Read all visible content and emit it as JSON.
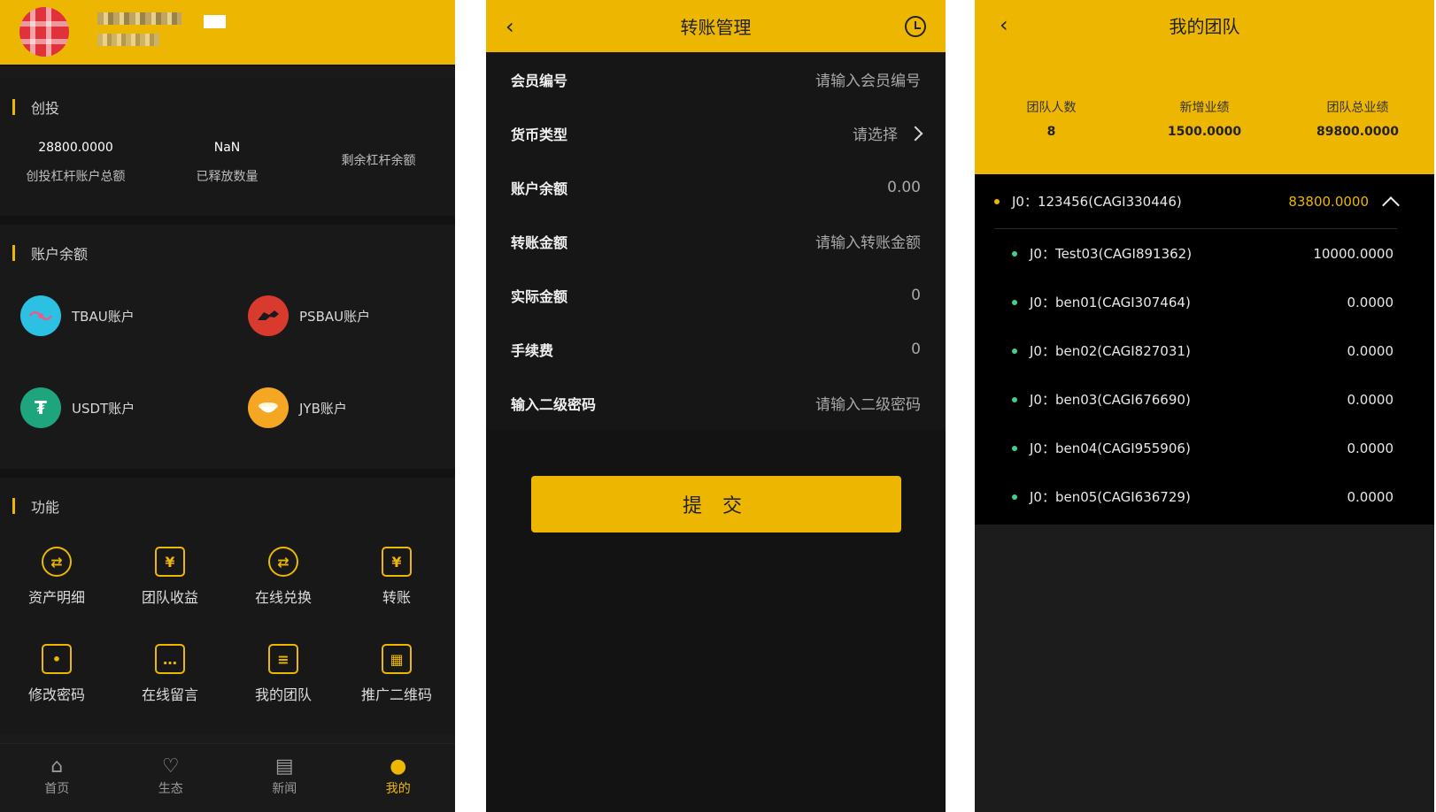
{
  "colors": {
    "accent": "#edb701",
    "dark_bg": "#1b1b1b",
    "green_dot": "#3ed28b"
  },
  "panel1": {
    "sections": {
      "cy_title": "创投",
      "accounts_title": "账户余额",
      "functions_title": "功能"
    },
    "cy_stats": [
      {
        "value": "28800.0000",
        "label": "创投杠杆账户总额"
      },
      {
        "value": "NaN",
        "label": "已释放数量"
      },
      {
        "value": "",
        "label": "剩余杠杆余额"
      }
    ],
    "accounts": [
      {
        "label": "TBAU账户",
        "icon": "tbau-coin-icon",
        "color": "#2cc1e2"
      },
      {
        "label": "PSBAU账户",
        "icon": "psbau-horse-icon",
        "color": "#d93a2e"
      },
      {
        "label": "USDT账户",
        "icon": "tether-icon",
        "color": "#1ea57e",
        "glyph": "₮"
      },
      {
        "label": "JYB账户",
        "icon": "gold-ingot-icon",
        "color": "#f5a623"
      }
    ],
    "functions": [
      {
        "label": "资产明细",
        "icon": "exchange-circle-icon",
        "glyph": "⇄"
      },
      {
        "label": "团队收益",
        "icon": "yen-box-icon",
        "glyph": "¥"
      },
      {
        "label": "在线兑换",
        "icon": "exchange-circle-icon",
        "glyph": "⇄"
      },
      {
        "label": "转账",
        "icon": "yen-transfer-icon",
        "glyph": "¥"
      },
      {
        "label": "修改密码",
        "icon": "lock-icon",
        "glyph": "•"
      },
      {
        "label": "在线留言",
        "icon": "message-icon",
        "glyph": "…"
      },
      {
        "label": "我的团队",
        "icon": "clipboard-icon",
        "glyph": "≡"
      },
      {
        "label": "推广二维码",
        "icon": "qr-code-icon",
        "glyph": "▦"
      }
    ],
    "tabs": [
      {
        "label": "首页",
        "icon": "home-icon",
        "glyph": "⌂",
        "active": false
      },
      {
        "label": "生态",
        "icon": "heart-circle-icon",
        "glyph": "♡",
        "active": false
      },
      {
        "label": "新闻",
        "icon": "newspaper-icon",
        "glyph": "▤",
        "active": false
      },
      {
        "label": "我的",
        "icon": "user-icon",
        "glyph": "●",
        "active": true
      }
    ]
  },
  "panel2": {
    "title": "转账管理",
    "rows": [
      {
        "label": "会员编号",
        "value": "请输入会员编号"
      },
      {
        "label": "货币类型",
        "value": "请选择",
        "chevron": true
      },
      {
        "label": "账户余额",
        "value": "0.00"
      },
      {
        "label": "转账金额",
        "value": "请输入转账金额"
      },
      {
        "label": "实际金额",
        "value": "0"
      },
      {
        "label": "手续费",
        "value": "0"
      },
      {
        "label": "输入二级密码",
        "value": "请输入二级密码"
      }
    ],
    "submit_label": "提 交"
  },
  "panel3": {
    "title": "我的团队",
    "stats": [
      {
        "label": "团队人数",
        "value": "8"
      },
      {
        "label": "新增业绩",
        "value": "1500.0000"
      },
      {
        "label": "团队总业绩",
        "value": "89800.0000"
      }
    ],
    "parent": {
      "name": "J0：123456(CAGI330446)",
      "amount": "83800.0000"
    },
    "children": [
      {
        "name": "J0：Test03(CAGI891362)",
        "amount": "10000.0000"
      },
      {
        "name": "J0：ben01(CAGI307464)",
        "amount": "0.0000"
      },
      {
        "name": "J0：ben02(CAGI827031)",
        "amount": "0.0000"
      },
      {
        "name": "J0：ben03(CAGI676690)",
        "amount": "0.0000"
      },
      {
        "name": "J0：ben04(CAGI955906)",
        "amount": "0.0000"
      },
      {
        "name": "J0：ben05(CAGI636729)",
        "amount": "0.0000"
      }
    ]
  }
}
